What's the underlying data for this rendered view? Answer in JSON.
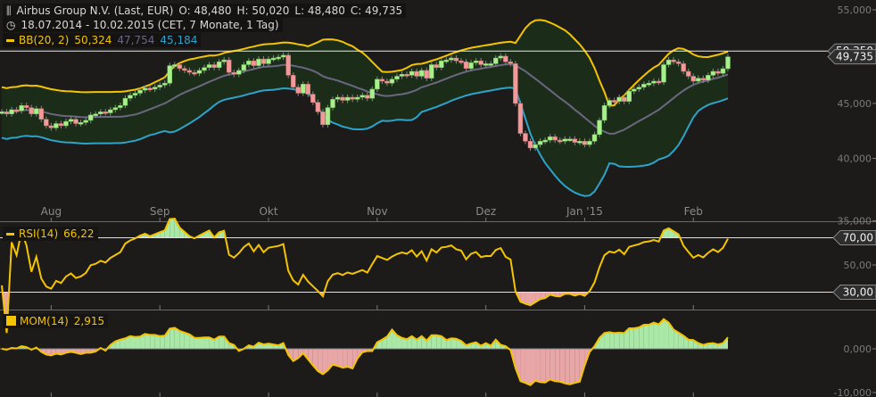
{
  "header": {
    "title": "Airbus Group N.V. (Last, EUR)",
    "open": "O: 48,480",
    "high": "H: 50,020",
    "low": "L: 48,480",
    "close": "C: 49,735",
    "range": "18.07.2014 - 10.02.2015 (CET, 7 Monate, 1 Tag)",
    "bb_label": "BB(20, 2)",
    "bb_upper": "50,324",
    "bb_middle": "47,754",
    "bb_lower": "45,184",
    "icon": "chart-bars-icon",
    "clock_icon": "clock-icon"
  },
  "rsi": {
    "label": "RSI(14)",
    "value": "66,22",
    "upper_tag": "70,00",
    "lower_tag": "30,00",
    "upper": 70,
    "lower": 30,
    "ticks": [
      {
        "v": 50,
        "label": "50,00"
      }
    ]
  },
  "mom": {
    "label": "MOM(14)",
    "value": "2,915",
    "ticks": [
      {
        "v": 0,
        "label": "0,000"
      },
      {
        "v": -10,
        "label": "-10,000"
      }
    ]
  },
  "colors": {
    "background": "#1c1b1a",
    "bb_upper": "#f5c400",
    "bb_middle": "#6c6680",
    "bb_lower": "#2ea2c9",
    "bb_fill": "#1b2d19",
    "up": "#a9f08c",
    "down": "#f29a9a",
    "indicator": "#f5c400",
    "pos_fill": "#a9e8a6",
    "neg_fill": "#e8a6a6"
  },
  "chart_data": {
    "type": "candlestick",
    "scale": "log",
    "ylim": [
      35000,
      55000
    ],
    "price_ticks": [
      {
        "v": 55,
        "label": "55,000"
      },
      {
        "v": 45,
        "label": "45,000"
      },
      {
        "v": 40,
        "label": "40,000"
      },
      {
        "v": 35,
        "label": "35,000"
      }
    ],
    "price_tags": [
      {
        "v": 50.35,
        "label": "50,350"
      },
      {
        "v": 49.735,
        "label": "49,735"
      }
    ],
    "reference_line": 50.35,
    "x_ticks": [
      {
        "label": "Aug",
        "index": 10
      },
      {
        "label": "Sep",
        "index": 32
      },
      {
        "label": "Okt",
        "index": 54
      },
      {
        "label": "Nov",
        "index": 76
      },
      {
        "label": "Dez",
        "index": 98
      },
      {
        "label": "Jan '15",
        "index": 118
      },
      {
        "label": "Feb",
        "index": 140
      }
    ],
    "close": [
      44.2,
      44.0,
      44.4,
      44.3,
      44.8,
      44.6,
      44.0,
      44.5,
      43.5,
      42.9,
      42.7,
      43.1,
      42.9,
      43.3,
      43.5,
      43.1,
      43.2,
      43.4,
      43.9,
      44.0,
      44.2,
      44.1,
      44.4,
      44.6,
      44.8,
      45.5,
      45.8,
      46.0,
      46.3,
      46.5,
      46.4,
      46.6,
      46.8,
      47.0,
      48.8,
      48.9,
      48.5,
      48.3,
      48.1,
      48.0,
      48.3,
      48.6,
      48.9,
      48.6,
      49.2,
      49.4,
      48.1,
      47.9,
      48.3,
      48.9,
      49.3,
      48.8,
      49.5,
      49.0,
      49.5,
      49.6,
      49.7,
      49.9,
      47.8,
      46.6,
      46.0,
      46.9,
      45.9,
      45.1,
      44.2,
      43.0,
      44.6,
      45.4,
      45.6,
      45.3,
      45.6,
      45.4,
      45.6,
      45.8,
      45.5,
      46.4,
      47.4,
      47.2,
      47.0,
      47.4,
      47.7,
      47.9,
      47.8,
      48.2,
      47.7,
      48.3,
      47.5,
      48.9,
      48.6,
      49.3,
      49.4,
      49.6,
      49.3,
      49.2,
      48.5,
      49.1,
      49.3,
      48.9,
      49.0,
      49.0,
      49.6,
      49.8,
      49.2,
      49.0,
      45.0,
      42.2,
      41.5,
      40.9,
      41.2,
      41.5,
      41.6,
      41.9,
      41.6,
      41.5,
      41.7,
      41.7,
      41.4,
      41.5,
      41.2,
      41.5,
      42.1,
      43.4,
      44.8,
      45.3,
      45.2,
      45.6,
      45.2,
      46.2,
      46.4,
      46.6,
      46.9,
      47.0,
      47.2,
      47.1,
      48.9,
      49.4,
      49.2,
      49.0,
      48.2,
      47.7,
      47.2,
      47.5,
      47.3,
      47.8,
      48.2,
      48.0,
      48.48,
      49.735
    ]
  }
}
